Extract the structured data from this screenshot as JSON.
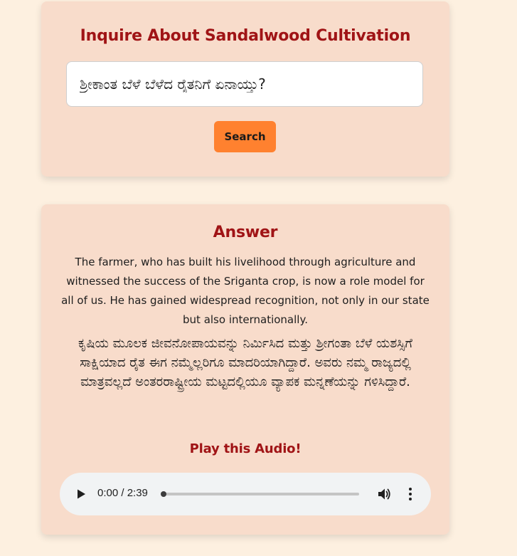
{
  "search": {
    "title": "Inquire About Sandalwood Cultivation",
    "query_value": "ಶ್ರೀಕಾಂತ ಬೆಳೆ ಬೆಳೆದ ರೈತನಿಗೆ ಏನಾಯ್ತು?",
    "button_label": "Search"
  },
  "answer": {
    "title": "Answer",
    "english_text": "The farmer, who has built his livelihood through agriculture and witnessed the success of the Sriganta crop, is now a role model for all of us. He has gained widespread recognition, not only in our state but also internationally.",
    "kannada_text": "ಕೃಷಿಯ ಮೂಲಕ ಜೀವನೋಪಾಯವನ್ನು ನಿರ್ಮಿಸಿದ ಮತ್ತು ಶ್ರೀಗಂತಾ ಬೆಳೆ ಯಶಸ್ಸಿಗೆ ಸಾಕ್ಷಿಯಾದ ರೈತ ಈಗ ನಮ್ಮೆಲ್ಲರಿಗೂ ಮಾದರಿಯಾಗಿದ್ದಾರೆ. ಅವರು ನಮ್ಮ ರಾಜ್ಯದಲ್ಲಿ ಮಾತ್ರವಲ್ಲದೆ ಅಂತರರಾಷ್ಟ್ರೀಯ ಮಟ್ಟದಲ್ಲಿಯೂ ವ್ಯಾಪಕ ಮನ್ನಣೆಯನ್ನು ಗಳಿಸಿದ್ದಾರೆ."
  },
  "audio": {
    "title": "Play this Audio!",
    "time_display": "0:00 / 2:39",
    "progress": 0,
    "play_icon": "play-icon",
    "volume_icon": "volume-icon",
    "more_icon": "more-vert-icon"
  },
  "colors": {
    "background": "#fdf0e0",
    "card": "#f8dccb",
    "heading": "#a01416",
    "button": "#ff812f",
    "player": "#f1f3f4"
  }
}
